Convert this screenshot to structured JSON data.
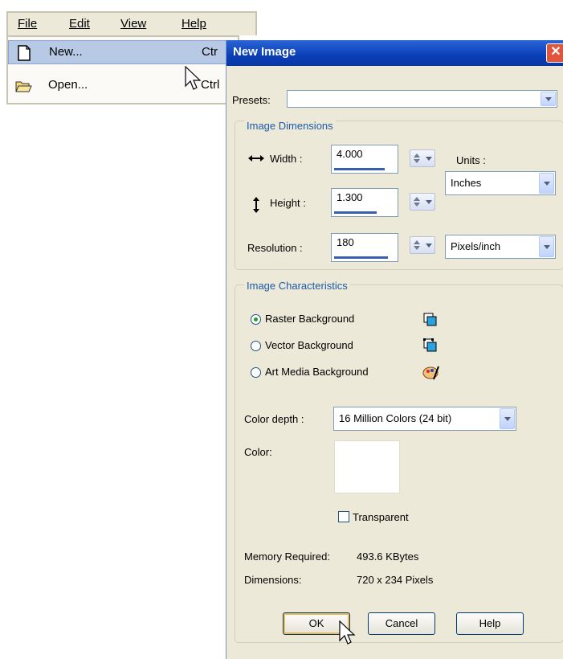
{
  "menubar": {
    "items": [
      {
        "label": "File",
        "mnemonic_index": 0
      },
      {
        "label": "Edit",
        "mnemonic_index": 0
      },
      {
        "label": "View",
        "mnemonic_index": 0
      },
      {
        "label": "Help",
        "mnemonic_index": 0
      }
    ]
  },
  "file_menu": {
    "new_label": "New...",
    "new_shortcut": "Ctr",
    "open_label": "Open...",
    "open_shortcut": "Ctrl"
  },
  "dialog": {
    "title": "New Image",
    "close_glyph": "✕",
    "presets_label": "Presets:",
    "presets_value": "",
    "image_dimensions": {
      "group_title": "Image Dimensions",
      "width_label": "Width :",
      "width_value": "4.000",
      "width_progress": 0.85,
      "height_label": "Height :",
      "height_value": "1.300",
      "height_progress": 0.72,
      "resolution_label": "Resolution :",
      "resolution_value": "180",
      "resolution_progress": 0.9,
      "units_label": "Units :",
      "units_value": "Inches",
      "resolution_units_value": "Pixels/inch"
    },
    "image_characteristics": {
      "group_title": "Image Characteristics",
      "options": [
        {
          "label": "Raster Background",
          "selected": true,
          "icon": "raster-layer-icon"
        },
        {
          "label": "Vector Background",
          "selected": false,
          "icon": "vector-layer-icon"
        },
        {
          "label": "Art Media Background",
          "selected": false,
          "icon": "art-media-icon"
        }
      ],
      "color_depth_label": "Color depth :",
      "color_depth_value": "16 Million Colors (24 bit)",
      "color_label": "Color:",
      "color_swatch": "#ffffff",
      "transparent_label": "Transparent",
      "transparent_checked": false
    },
    "memory_label": "Memory Required:",
    "memory_value": "493.6 KBytes",
    "dimensions_label": "Dimensions:",
    "dimensions_value": "720 x 234 Pixels",
    "buttons": {
      "ok": "OK",
      "cancel": "Cancel",
      "help": "Help"
    }
  },
  "colors": {
    "title_bar": "#0a3fb8",
    "group_title": "#1e5aa8",
    "dialog_bg": "#ece9d8",
    "selection": "#b8c9e6"
  }
}
